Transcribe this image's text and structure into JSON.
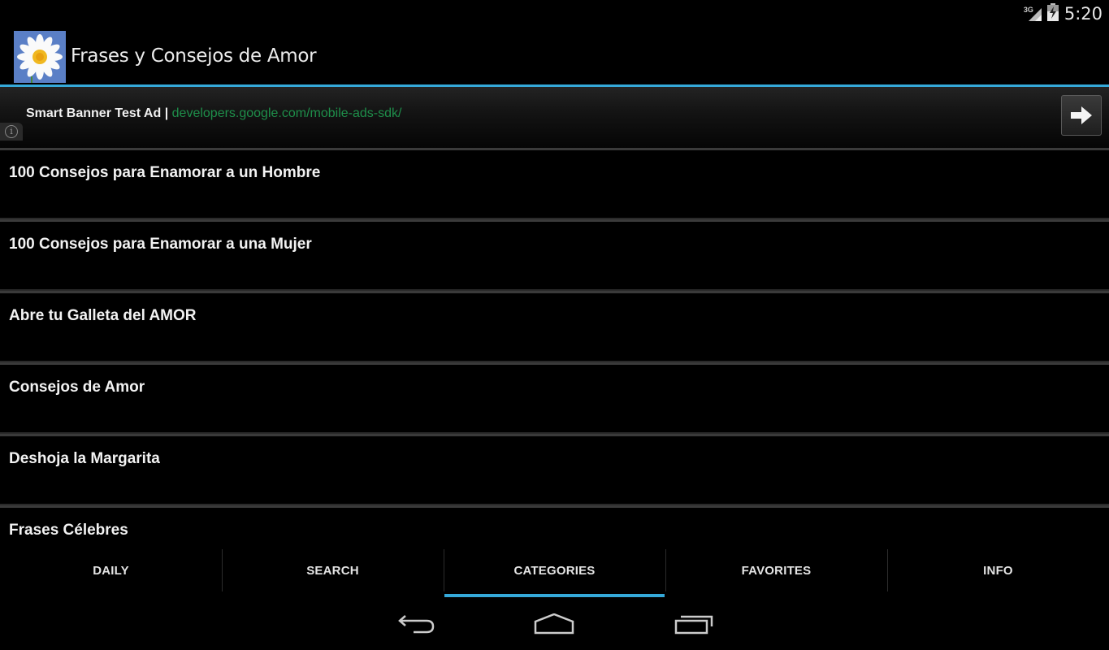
{
  "status_bar": {
    "network": "3G",
    "time": "5:20"
  },
  "action_bar": {
    "app_title": "Frases y Consejos de Amor",
    "accent_color": "#35a9d9"
  },
  "ad_banner": {
    "title": "Smart Banner Test Ad",
    "separator": " | ",
    "url": "developers.google.com/mobile-ads-sdk/",
    "url_color": "#1e8e4a",
    "info_icon": "info-icon",
    "action_icon": "arrow-right-icon"
  },
  "list": {
    "items": [
      {
        "label": "100 Consejos para Enamorar a un Hombre"
      },
      {
        "label": "100 Consejos para Enamorar a una Mujer"
      },
      {
        "label": "Abre tu Galleta del AMOR"
      },
      {
        "label": "Consejos de Amor"
      },
      {
        "label": "Deshoja la Margarita"
      },
      {
        "label": "Frases Célebres"
      }
    ]
  },
  "tabs": {
    "items": [
      {
        "label": "DAILY"
      },
      {
        "label": "SEARCH"
      },
      {
        "label": "CATEGORIES"
      },
      {
        "label": "FAVORITES"
      },
      {
        "label": "INFO"
      }
    ],
    "active": "CATEGORIES"
  },
  "nav_bar": {
    "back": "back-icon",
    "home": "home-icon",
    "recents": "recents-icon"
  }
}
